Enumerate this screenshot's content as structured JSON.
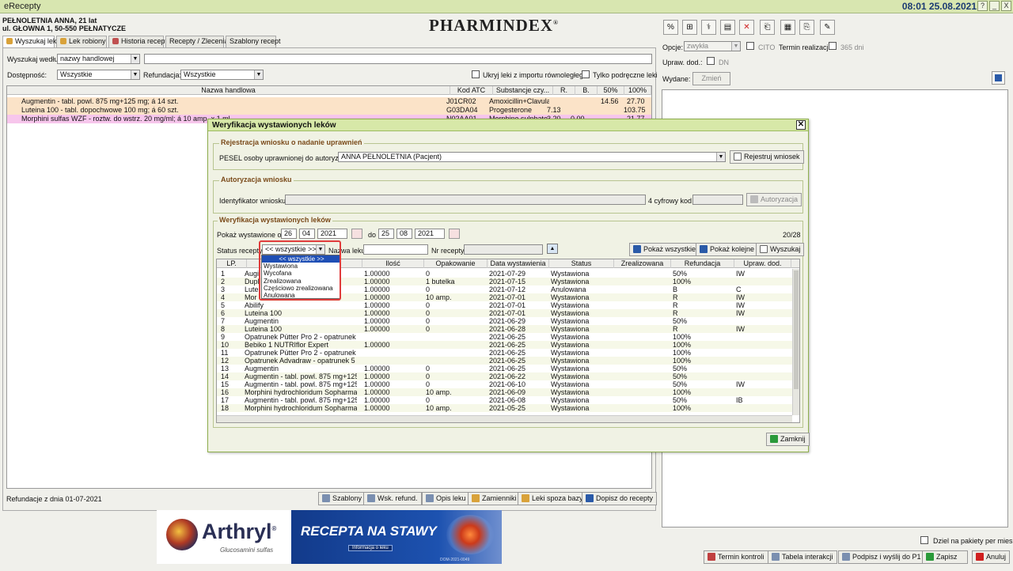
{
  "window": {
    "title": "eRecepty",
    "clock": "08:01 25.08.2021",
    "buttons": [
      "?",
      "_",
      "X"
    ]
  },
  "patient": {
    "line1": "PEŁNOLETNIA ANNA,  21 lat",
    "line2": "ul. GŁOWNA 1, 50-550 PEŁNATYCZE"
  },
  "logo": {
    "text": "PHARMINDEX",
    "mark": "®"
  },
  "tabs": [
    "Wyszukaj lek",
    "Lek robiony",
    "Historia recept",
    "Recepty / Zlecenia",
    "Szablony recept"
  ],
  "search": {
    "by_label": "Wyszukaj według",
    "by_value": "nazwy handlowej",
    "availability_label": "Dostępność:",
    "availability_value": "Wszystkie",
    "refund_label": "Refundacja:",
    "refund_value": "Wszystkie",
    "hide_import": "Ukryj leki z importu równoległego",
    "only_handy": "Tylko podręczne leki"
  },
  "drug_grid": {
    "headers": [
      "Nazwa handlowa",
      "Kod ATC",
      "Substancje czy...",
      "R.",
      "B.",
      "50%",
      "100%"
    ],
    "rows": [
      {
        "name": "Augmentin - tabl. powl. 875 mg+125 mg; á 14 szt.",
        "atc": "J01CR02",
        "sub": "Amoxicillin+Clavulai",
        "r": "",
        "b": "",
        "p50": "14.56",
        "p100": "27.70"
      },
      {
        "name": "Luteina 100 - tabl. dopochwowe 100 mg; á 60 szt.",
        "atc": "G03DA04",
        "sub": "Progesterone",
        "r": "7.13",
        "b": "",
        "p50": "",
        "p100": "103.75"
      },
      {
        "name": "Morphini sulfas WZF - roztw. do wstrz. 20 mg/ml; á 10 amp. x 1 ml",
        "atc": "N02AA01",
        "sub": "Morphine sulphate",
        "r": "3.20",
        "b": "0.00",
        "p50": "",
        "p100": "21.77"
      }
    ]
  },
  "bottom": {
    "refund_date": "Refundacje z dnia 01-07-2021",
    "buttons": [
      "Szablony",
      "Wsk. refund.",
      "Opis leku",
      "Zamienniki",
      "Leki spoza bazy",
      "Dopisz do recepty"
    ]
  },
  "banner": {
    "brand": "Arthryl",
    "brand_mark": "®",
    "brand_sub": "Glucosamini sulfas",
    "headline": "RECEPTA NA STAWY",
    "info": "Informacja o leku",
    "code": "DOM-2021-0049"
  },
  "right": {
    "options_label": "Opcje:",
    "options_value": "zwykła",
    "cito": "CITO",
    "termin": "Termin realizacji",
    "days": "365 dni",
    "upraw_label": "Upraw. dod.:",
    "dn": "DN",
    "wydane_label": "Wydane:",
    "zmien": "Zmień",
    "split": "Dziel na pakiety per miesiąc",
    "buttons": [
      "Termin kontroli",
      "Tabela interakcji",
      "Podpisz i wyślij do P1",
      "Zapisz",
      "Anuluj"
    ],
    "toolbar": [
      "%",
      "⊞",
      "⚕",
      "▤",
      "✕",
      "⎗",
      "▦",
      "⎘",
      "✎"
    ]
  },
  "dialog": {
    "title": "Weryfikacja wystawionych leków",
    "g1_title": "Rejestracja wniosku o nadanie uprawnień",
    "pesel_label": "PESEL osoby uprawnionej do autoryzacji",
    "pesel_value": "ANNA PEŁNOLETNIA (Pacjent)",
    "register_btn": "Rejestruj wniosek",
    "g2_title": "Autoryzacja wniosku",
    "ident_label": "Identyfikator wniosku",
    "code_label": "4 cyfrowy kod",
    "auth_btn": "Autoryzacja",
    "g3_title": "Weryfikacja wystawionych leków",
    "from_label": "Pokaż wystawione od",
    "from": [
      "26",
      "04",
      "2021"
    ],
    "to_label": "do",
    "to": [
      "25",
      "08",
      "2021"
    ],
    "count": "20/28",
    "status_label": "Status recepty",
    "status_value": "<< wszystkie >>",
    "drug_name_label": "Nazwa leku",
    "nr_label": "Nr recepty",
    "btn_all": "Pokaż wszystkie",
    "btn_next": "Pokaż kolejne",
    "btn_search": "Wyszukaj",
    "close_btn": "Zamknij",
    "dropdown": [
      "<< wszystkie >>",
      "Wystawiona",
      "Wycofana",
      "Zrealizowana",
      "Częściowo zrealizowana",
      "Anulowana"
    ],
    "headers": [
      "LP.",
      "",
      "Ilość",
      "Opakowanie",
      "Data wystawienia",
      "Status",
      "Zrealizowana",
      "Refundacja",
      "Upraw. dod."
    ],
    "rows": [
      {
        "lp": "1",
        "name": "Augi",
        "qty": "1.00000",
        "pack": "0",
        "date": "2021-07-29",
        "status": "Wystawiona",
        "real": "",
        "refund": "50%",
        "upraw": "IW"
      },
      {
        "lp": "2",
        "name": "Dupl",
        "qty": "1.00000",
        "pack": "1 butelka",
        "date": "2021-07-15",
        "status": "Wystawiona",
        "real": "",
        "refund": "100%",
        "upraw": ""
      },
      {
        "lp": "3",
        "name": "Lute",
        "qty": "1.00000",
        "pack": "0",
        "date": "2021-07-12",
        "status": "Anulowana",
        "real": "",
        "refund": "B",
        "upraw": "C"
      },
      {
        "lp": "4",
        "name": "Mor",
        "qty": "1.00000",
        "pack": "10 amp.",
        "date": "2021-07-01",
        "status": "Wystawiona",
        "real": "",
        "refund": "R",
        "upraw": "IW"
      },
      {
        "lp": "5",
        "name": "Abilify",
        "qty": "1.00000",
        "pack": "0",
        "date": "2021-07-01",
        "status": "Wystawiona",
        "real": "",
        "refund": "R",
        "upraw": "IW"
      },
      {
        "lp": "6",
        "name": "Luteina 100",
        "qty": "1.00000",
        "pack": "0",
        "date": "2021-07-01",
        "status": "Wystawiona",
        "real": "",
        "refund": "R",
        "upraw": "IW"
      },
      {
        "lp": "7",
        "name": "Augmentin",
        "qty": "1.00000",
        "pack": "0",
        "date": "2021-06-29",
        "status": "Wystawiona",
        "real": "",
        "refund": "50%",
        "upraw": ""
      },
      {
        "lp": "8",
        "name": "Luteina 100",
        "qty": "1.00000",
        "pack": "0",
        "date": "2021-06-28",
        "status": "Wystawiona",
        "real": "",
        "refund": "R",
        "upraw": "IW"
      },
      {
        "lp": "9",
        "name": "Opatrunek Pütter Pro 2 - opatrunek",
        "qty": "",
        "pack": "",
        "date": "2021-06-25",
        "status": "Wystawiona",
        "real": "",
        "refund": "100%",
        "upraw": ""
      },
      {
        "lp": "10",
        "name": "Bebiko 1 NUTRIflor Expert",
        "qty": "1.00000",
        "pack": "",
        "date": "2021-06-25",
        "status": "Wystawiona",
        "real": "",
        "refund": "100%",
        "upraw": ""
      },
      {
        "lp": "11",
        "name": "Opatrunek Pütter Pro 2 - opatrunek",
        "qty": "",
        "pack": "",
        "date": "2021-06-25",
        "status": "Wystawiona",
        "real": "",
        "refund": "100%",
        "upraw": ""
      },
      {
        "lp": "12",
        "name": "Opatrunek Advadraw - opatrunek 5 cr",
        "qty": "",
        "pack": "",
        "date": "2021-06-25",
        "status": "Wystawiona",
        "real": "",
        "refund": "100%",
        "upraw": ""
      },
      {
        "lp": "13",
        "name": "Augmentin",
        "qty": "1.00000",
        "pack": "0",
        "date": "2021-06-25",
        "status": "Wystawiona",
        "real": "",
        "refund": "50%",
        "upraw": ""
      },
      {
        "lp": "14",
        "name": "Augmentin - tabl. powl. 875 mg+125",
        "qty": "1.00000",
        "pack": "0",
        "date": "2021-06-22",
        "status": "Wystawiona",
        "real": "",
        "refund": "50%",
        "upraw": ""
      },
      {
        "lp": "15",
        "name": "Augmentin - tabl. powl. 875 mg+125",
        "qty": "1.00000",
        "pack": "0",
        "date": "2021-06-10",
        "status": "Wystawiona",
        "real": "",
        "refund": "50%",
        "upraw": "IW"
      },
      {
        "lp": "16",
        "name": "Morphini hydrochloridum Sopharma - ro",
        "qty": "1.00000",
        "pack": "10 amp.",
        "date": "2021-06-09",
        "status": "Wystawiona",
        "real": "",
        "refund": "100%",
        "upraw": ""
      },
      {
        "lp": "17",
        "name": "Augmentin - tabl. powl. 875 mg+125",
        "qty": "1.00000",
        "pack": "0",
        "date": "2021-06-08",
        "status": "Wystawiona",
        "real": "",
        "refund": "50%",
        "upraw": "IB"
      },
      {
        "lp": "18",
        "name": "Morphini hydrochloridum Sopharma - ro",
        "qty": "1.00000",
        "pack": "10 amp.",
        "date": "2021-05-25",
        "status": "Wystawiona",
        "real": "",
        "refund": "100%",
        "upraw": ""
      }
    ]
  }
}
